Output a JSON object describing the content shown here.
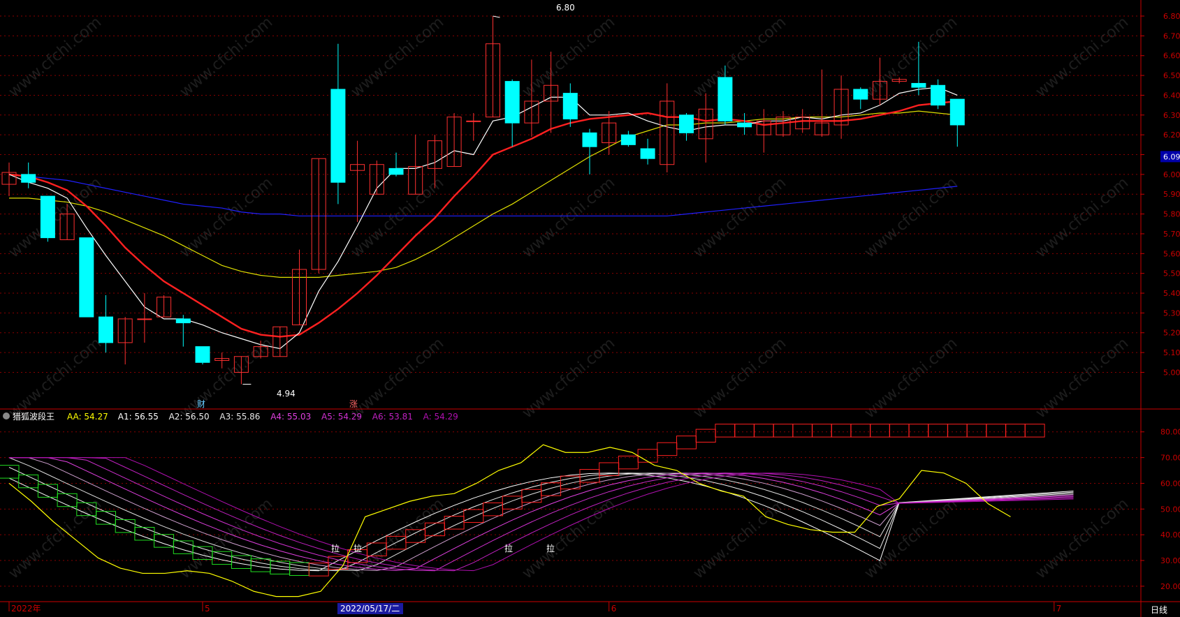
{
  "indicator": {
    "name": "猎狐波段王",
    "values": [
      {
        "label": "AA: 54.27",
        "color": "#ffff00"
      },
      {
        "label": "A1: 56.55",
        "color": "#ffffff"
      },
      {
        "label": "A2: 56.50",
        "color": "#f0f0f0"
      },
      {
        "label": "A3: 55.86",
        "color": "#e6e6e6"
      },
      {
        "label": "A4: 55.03",
        "color": "#e040e0"
      },
      {
        "label": "A5: 54.29",
        "color": "#d030d0"
      },
      {
        "label": "A6: 53.81",
        "color": "#c020c0"
      },
      {
        "label": "A: 54.29",
        "color": "#b010b0"
      }
    ],
    "ylim": [
      14,
      84
    ],
    "ticks": [
      "80.00",
      "70.00",
      "60.00",
      "50.00",
      "40.00",
      "30.00",
      "20.00"
    ]
  },
  "price_axis": {
    "ylim": [
      4.85,
      6.86
    ],
    "ticks": [
      "6.80",
      "6.70",
      "6.60",
      "6.50",
      "6.40",
      "6.30",
      "6.20",
      "6.10",
      "6.00",
      "5.90",
      "5.80",
      "5.70",
      "5.60",
      "5.50",
      "5.40",
      "5.30",
      "5.20",
      "5.10",
      "5.00"
    ],
    "current": "6.09"
  },
  "annotations": {
    "high": "6.80",
    "low": "4.94",
    "cai": "财",
    "zhang": "涨",
    "la": "拉"
  },
  "x_axis": {
    "labels": [
      {
        "text": "2022年",
        "idx": 0
      },
      {
        "text": "5",
        "idx": 10
      },
      {
        "text": "6",
        "idx": 31
      },
      {
        "text": "7",
        "idx": 54
      }
    ],
    "cursor": "2022/05/17/二",
    "cursor_idx": 20,
    "period": "日线"
  },
  "watermark": "www.cfchi.com",
  "colors": {
    "up": "#ff3030",
    "down": "#00ffff",
    "grid": "#8b0000",
    "axis": "#cc0000",
    "ma5": "#ffffff",
    "ma10": "#ff2020",
    "ma20": "#e0e000",
    "ma60": "#2020ff"
  },
  "chart_data": {
    "type": "candlestick",
    "candles": [
      {
        "o": 5.95,
        "c": 6.01,
        "h": 6.06,
        "l": 5.89
      },
      {
        "o": 6.0,
        "c": 5.96,
        "h": 6.06,
        "l": 5.93
      },
      {
        "o": 5.89,
        "c": 5.68,
        "h": 5.89,
        "l": 5.66
      },
      {
        "o": 5.67,
        "c": 5.8,
        "h": 5.85,
        "l": 5.67
      },
      {
        "o": 5.68,
        "c": 5.28,
        "h": 5.68,
        "l": 5.28
      },
      {
        "o": 5.28,
        "c": 5.15,
        "h": 5.39,
        "l": 5.1
      },
      {
        "o": 5.15,
        "c": 5.27,
        "h": 5.28,
        "l": 5.04
      },
      {
        "o": 5.27,
        "c": 5.27,
        "h": 5.4,
        "l": 5.15
      },
      {
        "o": 5.28,
        "c": 5.38,
        "h": 5.39,
        "l": 5.28
      },
      {
        "o": 5.27,
        "c": 5.25,
        "h": 5.29,
        "l": 5.13
      },
      {
        "o": 5.13,
        "c": 5.05,
        "h": 5.13,
        "l": 5.04
      },
      {
        "o": 5.06,
        "c": 5.07,
        "h": 5.1,
        "l": 5.02
      },
      {
        "o": 5.0,
        "c": 5.08,
        "h": 5.08,
        "l": 4.94
      },
      {
        "o": 5.08,
        "c": 5.13,
        "h": 5.16,
        "l": 5.07
      },
      {
        "o": 5.08,
        "c": 5.23,
        "h": 5.23,
        "l": 5.08
      },
      {
        "o": 5.24,
        "c": 5.52,
        "h": 5.62,
        "l": 5.24
      },
      {
        "o": 5.52,
        "c": 6.08,
        "h": 6.08,
        "l": 5.5
      },
      {
        "o": 6.43,
        "c": 5.96,
        "h": 6.66,
        "l": 5.85
      },
      {
        "o": 6.02,
        "c": 6.05,
        "h": 6.17,
        "l": 5.76
      },
      {
        "o": 5.9,
        "c": 6.05,
        "h": 6.07,
        "l": 5.9
      },
      {
        "o": 6.03,
        "c": 6.0,
        "h": 6.11,
        "l": 5.99
      },
      {
        "o": 5.9,
        "c": 6.04,
        "h": 6.2,
        "l": 5.9
      },
      {
        "o": 6.03,
        "c": 6.17,
        "h": 6.2,
        "l": 5.93
      },
      {
        "o": 6.04,
        "c": 6.29,
        "h": 6.31,
        "l": 6.04
      },
      {
        "o": 6.27,
        "c": 6.27,
        "h": 6.31,
        "l": 6.17
      },
      {
        "o": 6.29,
        "c": 6.66,
        "h": 6.8,
        "l": 6.29
      },
      {
        "o": 6.47,
        "c": 6.26,
        "h": 6.48,
        "l": 6.14
      },
      {
        "o": 6.26,
        "c": 6.37,
        "h": 6.58,
        "l": 6.19
      },
      {
        "o": 6.37,
        "c": 6.45,
        "h": 6.62,
        "l": 6.21
      },
      {
        "o": 6.41,
        "c": 6.28,
        "h": 6.46,
        "l": 6.24
      },
      {
        "o": 6.21,
        "c": 6.14,
        "h": 6.23,
        "l": 6.0
      },
      {
        "o": 6.16,
        "c": 6.26,
        "h": 6.32,
        "l": 6.1
      },
      {
        "o": 6.2,
        "c": 6.15,
        "h": 6.22,
        "l": 6.14
      },
      {
        "o": 6.13,
        "c": 6.08,
        "h": 6.18,
        "l": 6.05
      },
      {
        "o": 6.05,
        "c": 6.37,
        "h": 6.46,
        "l": 6.01
      },
      {
        "o": 6.3,
        "c": 6.21,
        "h": 6.31,
        "l": 6.17
      },
      {
        "o": 6.18,
        "c": 6.33,
        "h": 6.41,
        "l": 6.06
      },
      {
        "o": 6.49,
        "c": 6.27,
        "h": 6.55,
        "l": 6.25
      },
      {
        "o": 6.26,
        "c": 6.24,
        "h": 6.31,
        "l": 6.2
      },
      {
        "o": 6.2,
        "c": 6.27,
        "h": 6.33,
        "l": 6.11
      },
      {
        "o": 6.2,
        "c": 6.29,
        "h": 6.32,
        "l": 6.19
      },
      {
        "o": 6.23,
        "c": 6.29,
        "h": 6.33,
        "l": 6.21
      },
      {
        "o": 6.2,
        "c": 6.26,
        "h": 6.53,
        "l": 6.19
      },
      {
        "o": 6.25,
        "c": 6.43,
        "h": 6.5,
        "l": 6.18
      },
      {
        "o": 6.43,
        "c": 6.38,
        "h": 6.44,
        "l": 6.33
      },
      {
        "o": 6.38,
        "c": 6.47,
        "h": 6.59,
        "l": 6.35
      },
      {
        "o": 6.47,
        "c": 6.48,
        "h": 6.49,
        "l": 6.46
      },
      {
        "o": 6.46,
        "c": 6.44,
        "h": 6.67,
        "l": 6.4
      },
      {
        "o": 6.45,
        "c": 6.35,
        "h": 6.48,
        "l": 6.33
      },
      {
        "o": 6.38,
        "c": 6.25,
        "h": 6.38,
        "l": 6.14
      }
    ],
    "ma5": [
      6.0,
      5.96,
      5.93,
      5.88,
      5.73,
      5.59,
      5.46,
      5.33,
      5.27,
      5.27,
      5.24,
      5.2,
      5.17,
      5.14,
      5.12,
      5.2,
      5.41,
      5.56,
      5.74,
      5.93,
      6.03,
      6.03,
      6.06,
      6.12,
      6.1,
      6.27,
      6.29,
      6.34,
      6.39,
      6.39,
      6.3,
      6.3,
      6.31,
      6.27,
      6.24,
      6.22,
      6.24,
      6.25,
      6.25,
      6.27,
      6.27,
      6.29,
      6.28,
      6.3,
      6.31,
      6.35,
      6.41,
      6.43,
      6.44,
      6.4
    ],
    "ma10": [
      6.0,
      5.99,
      5.96,
      5.92,
      5.84,
      5.74,
      5.63,
      5.54,
      5.46,
      5.4,
      5.34,
      5.28,
      5.22,
      5.19,
      5.18,
      5.19,
      5.25,
      5.32,
      5.4,
      5.49,
      5.59,
      5.69,
      5.78,
      5.89,
      5.99,
      6.1,
      6.14,
      6.18,
      6.23,
      6.26,
      6.28,
      6.29,
      6.3,
      6.31,
      6.29,
      6.29,
      6.27,
      6.28,
      6.27,
      6.25,
      6.26,
      6.27,
      6.27,
      6.27,
      6.28,
      6.3,
      6.32,
      6.35,
      6.36,
      6.37
    ],
    "ma20": [
      5.88,
      5.88,
      5.87,
      5.86,
      5.84,
      5.81,
      5.77,
      5.73,
      5.69,
      5.64,
      5.59,
      5.54,
      5.51,
      5.49,
      5.48,
      5.48,
      5.48,
      5.49,
      5.5,
      5.51,
      5.53,
      5.57,
      5.62,
      5.68,
      5.74,
      5.8,
      5.85,
      5.91,
      5.97,
      6.03,
      6.09,
      6.14,
      6.19,
      6.22,
      6.25,
      6.25,
      6.26,
      6.26,
      6.27,
      6.28,
      6.28,
      6.29,
      6.29,
      6.29,
      6.3,
      6.31,
      6.31,
      6.32,
      6.31,
      6.3
    ],
    "ma60": [
      6.0,
      5.99,
      5.98,
      5.97,
      5.95,
      5.93,
      5.91,
      5.89,
      5.87,
      5.85,
      5.84,
      5.83,
      5.81,
      5.8,
      5.8,
      5.79,
      5.79,
      5.79,
      5.79,
      5.79,
      5.79,
      5.79,
      5.79,
      5.79,
      5.79,
      5.79,
      5.79,
      5.79,
      5.79,
      5.79,
      5.79,
      5.79,
      5.79,
      5.79,
      5.79,
      5.8,
      5.81,
      5.82,
      5.83,
      5.84,
      5.85,
      5.86,
      5.87,
      5.88,
      5.89,
      5.9,
      5.91,
      5.92,
      5.93,
      5.94
    ],
    "osc_yellow": [
      60,
      53,
      45,
      38,
      31,
      27,
      25,
      25,
      26,
      25,
      22,
      18,
      16,
      16,
      18,
      28,
      47,
      50,
      53,
      55,
      56,
      60,
      65,
      68,
      75,
      72,
      72,
      74,
      72,
      67,
      65,
      60,
      57,
      55,
      47,
      44,
      42,
      41,
      41,
      51,
      54,
      65,
      64,
      60,
      52,
      47
    ]
  }
}
